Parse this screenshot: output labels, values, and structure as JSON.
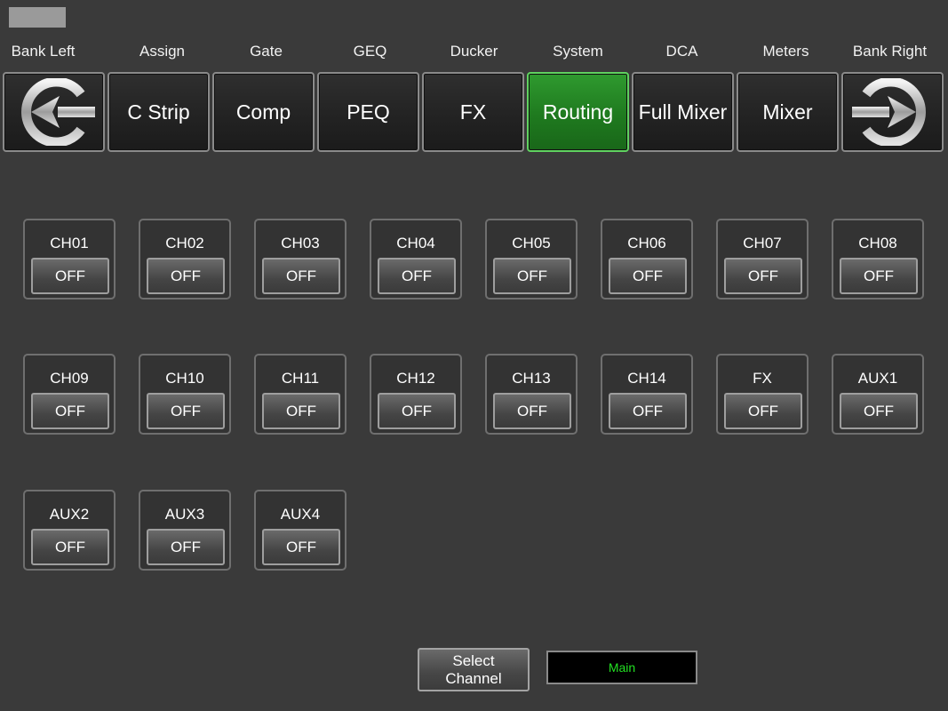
{
  "top_labels": [
    "Bank Left",
    "Assign",
    "Gate",
    "GEQ",
    "Ducker",
    "System",
    "DCA",
    "Meters",
    "Bank Right"
  ],
  "nav_buttons": [
    {
      "label": "C Strip"
    },
    {
      "label": "Comp"
    },
    {
      "label": "PEQ"
    },
    {
      "label": "FX"
    },
    {
      "label": "Routing",
      "active": true
    },
    {
      "label": "Full Mixer"
    },
    {
      "label": "Mixer"
    }
  ],
  "icons": {
    "bank_left": "bank-left-arrow-icon",
    "bank_right": "bank-right-arrow-icon"
  },
  "colors": {
    "active_tab": "#1f7a1f",
    "display_text": "#22e022"
  },
  "channels": [
    {
      "name": "CH01",
      "state": "OFF"
    },
    {
      "name": "CH02",
      "state": "OFF"
    },
    {
      "name": "CH03",
      "state": "OFF"
    },
    {
      "name": "CH04",
      "state": "OFF"
    },
    {
      "name": "CH05",
      "state": "OFF"
    },
    {
      "name": "CH06",
      "state": "OFF"
    },
    {
      "name": "CH07",
      "state": "OFF"
    },
    {
      "name": "CH08",
      "state": "OFF"
    },
    {
      "name": "CH09",
      "state": "OFF"
    },
    {
      "name": "CH10",
      "state": "OFF"
    },
    {
      "name": "CH11",
      "state": "OFF"
    },
    {
      "name": "CH12",
      "state": "OFF"
    },
    {
      "name": "CH13",
      "state": "OFF"
    },
    {
      "name": "CH14",
      "state": "OFF"
    },
    {
      "name": "FX",
      "state": "OFF"
    },
    {
      "name": "AUX1",
      "state": "OFF"
    },
    {
      "name": "AUX2",
      "state": "OFF"
    },
    {
      "name": "AUX3",
      "state": "OFF"
    },
    {
      "name": "AUX4",
      "state": "OFF"
    }
  ],
  "footer": {
    "select_channel": "Select\nChannel",
    "display": "Main"
  }
}
